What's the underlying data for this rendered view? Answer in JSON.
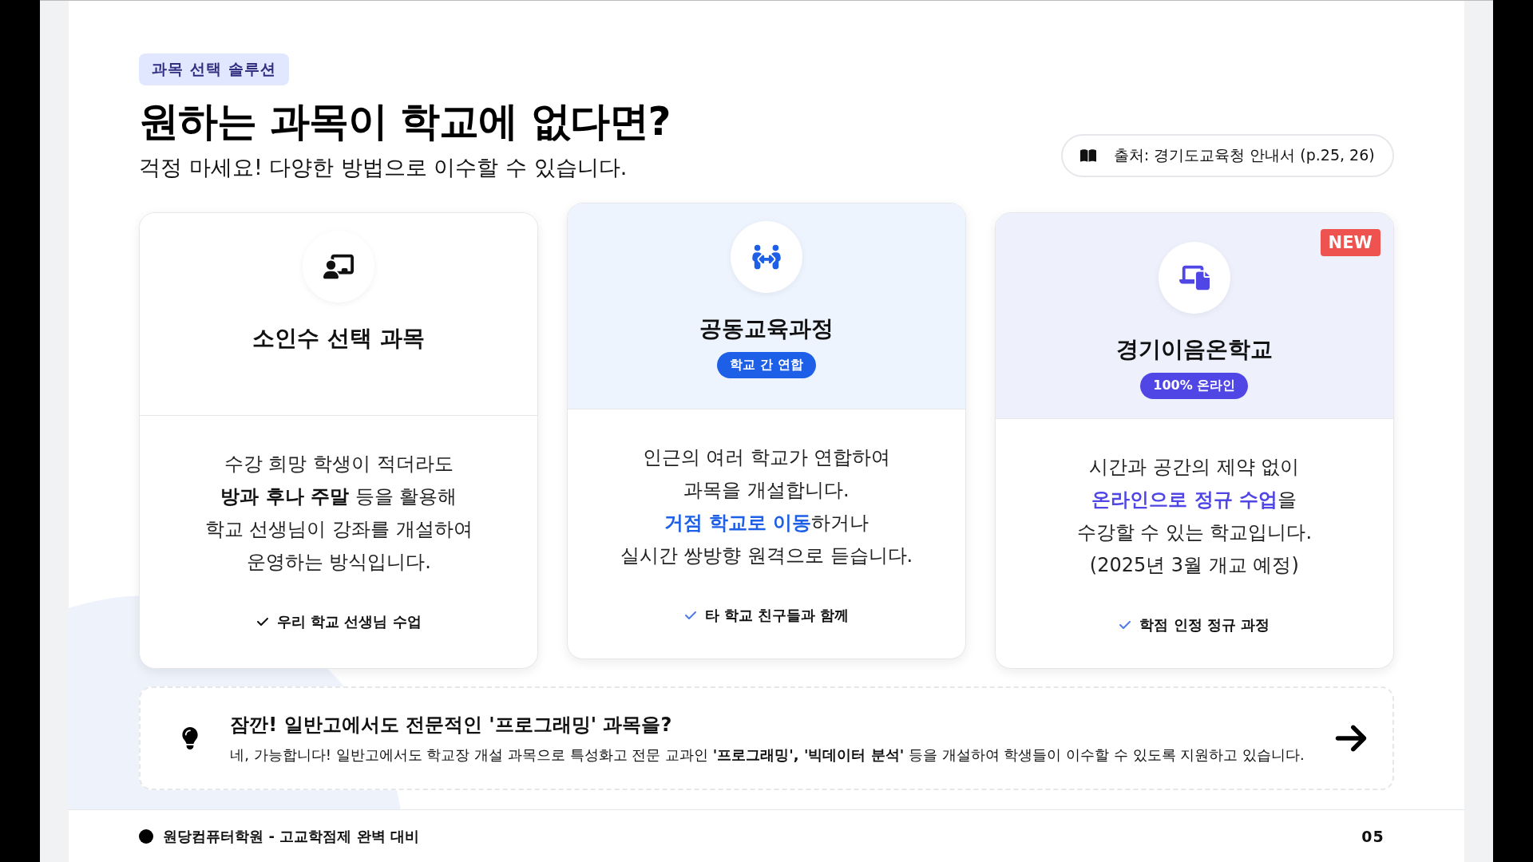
{
  "tag": "과목 선택 솔루션",
  "title": "원하는 과목이 학교에 없다면?",
  "subtitle": "걱정 마세요! 다양한 방법으로 이수할 수 있습니다.",
  "source": "출처: 경기도교육청 안내서 (p.25, 26)",
  "cards": [
    {
      "kind": "plain",
      "title": "소인수 선택 과목",
      "lines": [
        "수강 희망 학생이 적더라도",
        "**방과 후나 주말** 등을 활용해",
        "학교 선생님이 강좌를 개설하여",
        "운영하는 방식입니다."
      ],
      "check": "우리 학교 선생님 수업"
    },
    {
      "kind": "blue",
      "title": "공동교육과정",
      "badge": "학교 간 연합",
      "lines": [
        "인근의 여러 학교가 연합하여",
        "과목을 개설합니다.",
        "**거점 학교로 이동**하거나",
        "실시간 쌍방향 원격으로 듣습니다."
      ],
      "check": "타 학교 친구들과 함께"
    },
    {
      "kind": "purple",
      "title": "경기이음온학교",
      "badge": "100% 온라인",
      "new": "NEW",
      "lines": [
        "시간과 공간의 제약 없이",
        "**온라인으로 정규 수업**을",
        "수강할 수 있는 학교입니다.",
        "(2025년 3월 개교 예정)"
      ],
      "check": "학점 인정 정규 과정"
    }
  ],
  "tip": {
    "title": "잠깐! 일반고에서도 전문적인 '프로그래밍' 과목을?",
    "body": "네, 가능합니다! 일반고에서도 학교장 개설 과목으로 특성화고 전문 교과인 **'프로그래밍', '빅데이터 분석'** 등을 개설하여 학생들이 이수할 수 있도록 지원하고 있습니다."
  },
  "footer": {
    "text": "원당컴퓨터학원 - 고교학점제 완벽 대비",
    "page": "05"
  }
}
